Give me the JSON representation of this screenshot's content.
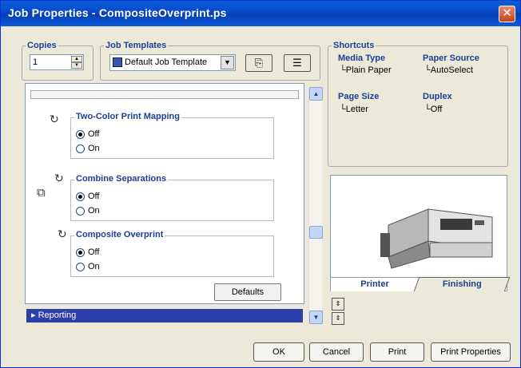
{
  "window": {
    "title": "Job Properties - CompositeOverprint.ps",
    "close_glyph": "✕"
  },
  "copies": {
    "label": "Copies",
    "value": "1"
  },
  "job_templates": {
    "label": "Job Templates",
    "selected": "Default Job Template",
    "icon": "printer-template-icon"
  },
  "toolbar": {
    "save_icon": "save-template-icon",
    "list_icon": "template-list-icon"
  },
  "options": {
    "groups": [
      {
        "title": "Two-Color Print Mapping",
        "options": [
          "Off",
          "On"
        ],
        "selected": "Off"
      },
      {
        "title": "Combine Separations",
        "options": [
          "Off",
          "On"
        ],
        "selected": "Off"
      },
      {
        "title": "Composite Overprint",
        "options": [
          "Off",
          "On"
        ],
        "selected": "Off"
      }
    ],
    "defaults_label": "Defaults"
  },
  "reporting": {
    "label": "▸ Reporting"
  },
  "shortcuts": {
    "label": "Shortcuts",
    "media_type": {
      "title": "Media Type",
      "value": "Plain Paper"
    },
    "paper_source": {
      "title": "Paper Source",
      "value": "AutoSelect"
    },
    "page_size": {
      "title": "Page Size",
      "value": "Letter"
    },
    "duplex": {
      "title": "Duplex",
      "value": "Off"
    }
  },
  "printer_tabs": {
    "printer": "Printer",
    "finishing": "Finishing"
  },
  "buttons": {
    "ok": "OK",
    "cancel": "Cancel",
    "print": "Print",
    "print_properties": "Print Properties"
  }
}
